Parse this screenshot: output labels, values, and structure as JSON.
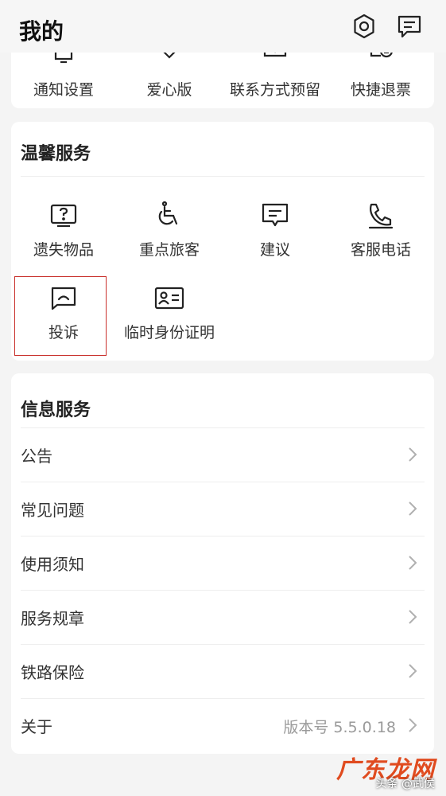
{
  "header": {
    "title": "我的",
    "icons": [
      "gear-icon",
      "message-icon"
    ]
  },
  "quick_actions": {
    "items": [
      {
        "label": "通知设置",
        "icon": "bell-icon"
      },
      {
        "label": "爱心版",
        "icon": "heart-icon"
      },
      {
        "label": "联系方式预留",
        "icon": "contact-shield-icon"
      },
      {
        "label": "快捷退票",
        "icon": "ticket-refund-icon"
      }
    ]
  },
  "warm_service": {
    "title": "温馨服务",
    "items": [
      {
        "label": "遗失物品",
        "icon": "question-box-icon"
      },
      {
        "label": "重点旅客",
        "icon": "wheelchair-icon"
      },
      {
        "label": "建议",
        "icon": "suggestion-icon"
      },
      {
        "label": "客服电话",
        "icon": "phone-icon"
      },
      {
        "label": "投诉",
        "icon": "complaint-icon"
      },
      {
        "label": "临时身份证明",
        "icon": "id-card-icon"
      }
    ]
  },
  "info_service": {
    "title": "信息服务",
    "rows": [
      {
        "label": "公告",
        "value": ""
      },
      {
        "label": "常见问题",
        "value": ""
      },
      {
        "label": "使用须知",
        "value": ""
      },
      {
        "label": "服务规章",
        "value": ""
      },
      {
        "label": "铁路保险",
        "value": ""
      },
      {
        "label": "关于",
        "value": "版本号 5.5.0.18"
      }
    ]
  },
  "watermark": {
    "logo": "广东龙网",
    "credit": "头条 @武侯"
  },
  "colors": {
    "background": "#f4f4f4",
    "card": "#ffffff",
    "highlight_border": "#c9302c",
    "watermark": "#e04b1f"
  }
}
